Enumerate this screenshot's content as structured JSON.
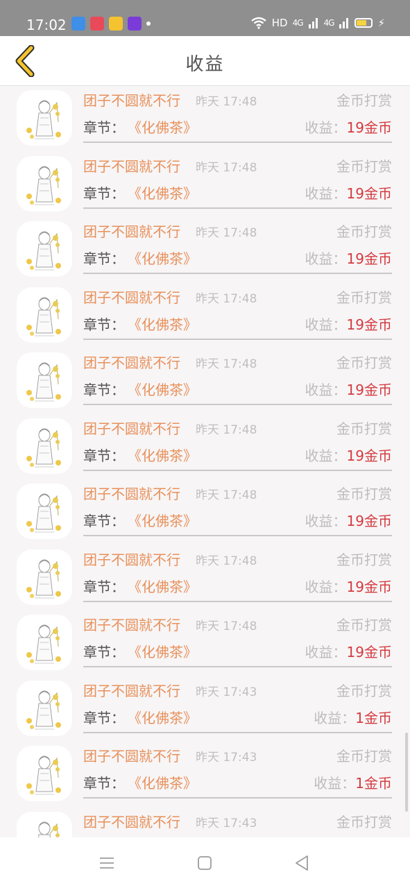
{
  "status_bar": {
    "time": "17:02",
    "notification_icons": [
      "app-icon-blue",
      "app-icon-red",
      "app-icon-yellow",
      "app-icon-purple"
    ],
    "wifi": "wifi-icon",
    "hd_label": "HD",
    "signal_1": "4G",
    "signal_2": "4G",
    "battery": "battery-icon"
  },
  "header": {
    "title": "收益",
    "back_icon": "chevron-left-icon",
    "back_color": "#f5c42c"
  },
  "list": {
    "chapter_label": "章节：",
    "income_label": "收益：",
    "items": [
      {
        "user": "团子不圆就不行",
        "time": "昨天 17:48",
        "type": "金币打赏",
        "chapter": "《化佛茶》",
        "income": "19金币"
      },
      {
        "user": "团子不圆就不行",
        "time": "昨天 17:48",
        "type": "金币打赏",
        "chapter": "《化佛茶》",
        "income": "19金币"
      },
      {
        "user": "团子不圆就不行",
        "time": "昨天 17:48",
        "type": "金币打赏",
        "chapter": "《化佛茶》",
        "income": "19金币"
      },
      {
        "user": "团子不圆就不行",
        "time": "昨天 17:48",
        "type": "金币打赏",
        "chapter": "《化佛茶》",
        "income": "19金币"
      },
      {
        "user": "团子不圆就不行",
        "time": "昨天 17:48",
        "type": "金币打赏",
        "chapter": "《化佛茶》",
        "income": "19金币"
      },
      {
        "user": "团子不圆就不行",
        "time": "昨天 17:48",
        "type": "金币打赏",
        "chapter": "《化佛茶》",
        "income": "19金币"
      },
      {
        "user": "团子不圆就不行",
        "time": "昨天 17:48",
        "type": "金币打赏",
        "chapter": "《化佛茶》",
        "income": "19金币"
      },
      {
        "user": "团子不圆就不行",
        "time": "昨天 17:48",
        "type": "金币打赏",
        "chapter": "《化佛茶》",
        "income": "19金币"
      },
      {
        "user": "团子不圆就不行",
        "time": "昨天 17:48",
        "type": "金币打赏",
        "chapter": "《化佛茶》",
        "income": "19金币"
      },
      {
        "user": "团子不圆就不行",
        "time": "昨天 17:43",
        "type": "金币打赏",
        "chapter": "《化佛茶》",
        "income": "1金币"
      },
      {
        "user": "团子不圆就不行",
        "time": "昨天 17:43",
        "type": "金币打赏",
        "chapter": "《化佛茶》",
        "income": "1金币"
      },
      {
        "user": "团子不圆就不行",
        "time": "昨天 17:43",
        "type": "金币打赏",
        "chapter": "",
        "income": ""
      }
    ]
  },
  "nav_bar": {
    "menu_icon": "menu-icon",
    "home_icon": "home-icon",
    "back_icon": "back-triangle-icon"
  },
  "colors": {
    "accent": "#f5c42c",
    "name_orange": "#e8905a",
    "income_red": "#d43a3f"
  }
}
